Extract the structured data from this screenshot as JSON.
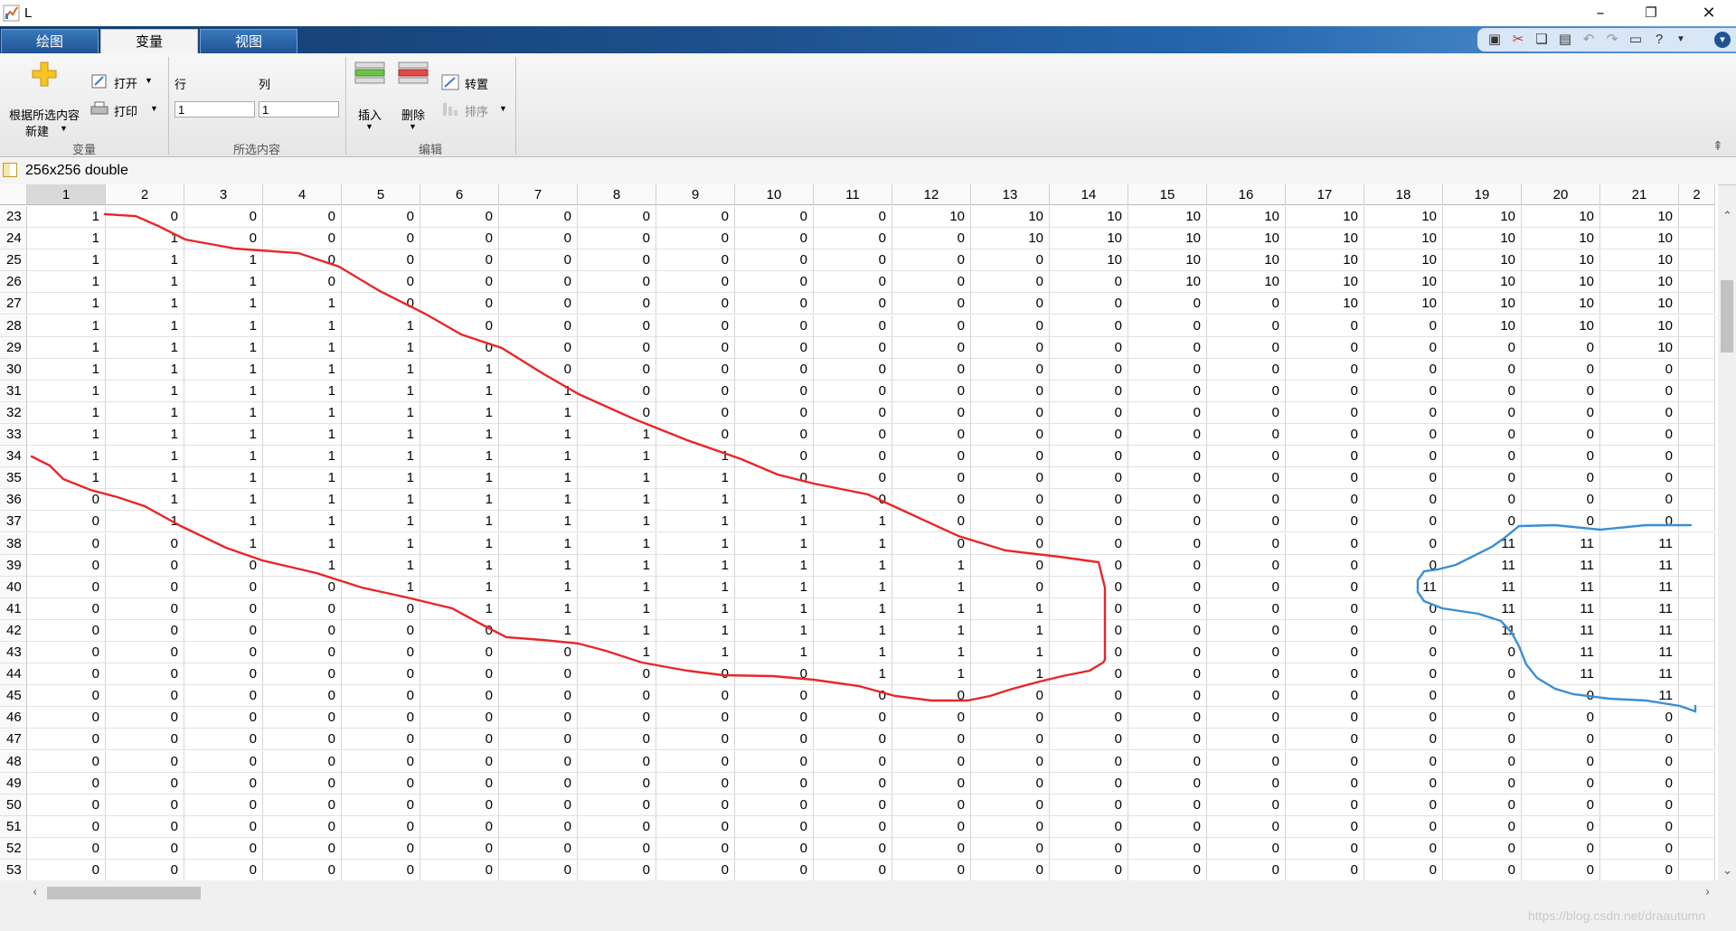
{
  "window": {
    "title": "L"
  },
  "ribbon_tabs": [
    "绘图",
    "变量",
    "视图"
  ],
  "ribbon": {
    "new_from_selection": [
      "根据所选内容",
      "新建"
    ],
    "open": "打开",
    "print": "打印",
    "row_label": "行",
    "col_label": "列",
    "row_value": "1",
    "col_value": "1",
    "insert": "插入",
    "delete": "删除",
    "transpose": "转置",
    "sort": "排序",
    "groups": [
      "变量",
      "所选内容",
      "编辑"
    ]
  },
  "variable": {
    "title": "256x256 double"
  },
  "table": {
    "columns": [
      "1",
      "2",
      "3",
      "4",
      "5",
      "6",
      "7",
      "8",
      "9",
      "10",
      "11",
      "12",
      "13",
      "14",
      "15",
      "16",
      "17",
      "18",
      "19",
      "20",
      "21",
      "2"
    ],
    "rows": [
      {
        "index": "23",
        "cells": [
          "1",
          "0",
          "0",
          "0",
          "0",
          "0",
          "0",
          "0",
          "0",
          "0",
          "0",
          "10",
          "10",
          "10",
          "10",
          "10",
          "10",
          "10",
          "10",
          "10",
          "10"
        ]
      },
      {
        "index": "24",
        "cells": [
          "1",
          "1",
          "0",
          "0",
          "0",
          "0",
          "0",
          "0",
          "0",
          "0",
          "0",
          "0",
          "10",
          "10",
          "10",
          "10",
          "10",
          "10",
          "10",
          "10",
          "10"
        ]
      },
      {
        "index": "25",
        "cells": [
          "1",
          "1",
          "1",
          "0",
          "0",
          "0",
          "0",
          "0",
          "0",
          "0",
          "0",
          "0",
          "0",
          "10",
          "10",
          "10",
          "10",
          "10",
          "10",
          "10",
          "10"
        ]
      },
      {
        "index": "26",
        "cells": [
          "1",
          "1",
          "1",
          "0",
          "0",
          "0",
          "0",
          "0",
          "0",
          "0",
          "0",
          "0",
          "0",
          "0",
          "10",
          "10",
          "10",
          "10",
          "10",
          "10",
          "10"
        ]
      },
      {
        "index": "27",
        "cells": [
          "1",
          "1",
          "1",
          "1",
          "0",
          "0",
          "0",
          "0",
          "0",
          "0",
          "0",
          "0",
          "0",
          "0",
          "0",
          "0",
          "10",
          "10",
          "10",
          "10",
          "10"
        ]
      },
      {
        "index": "28",
        "cells": [
          "1",
          "1",
          "1",
          "1",
          "1",
          "0",
          "0",
          "0",
          "0",
          "0",
          "0",
          "0",
          "0",
          "0",
          "0",
          "0",
          "0",
          "0",
          "10",
          "10",
          "10"
        ]
      },
      {
        "index": "29",
        "cells": [
          "1",
          "1",
          "1",
          "1",
          "1",
          "0",
          "0",
          "0",
          "0",
          "0",
          "0",
          "0",
          "0",
          "0",
          "0",
          "0",
          "0",
          "0",
          "0",
          "0",
          "10"
        ]
      },
      {
        "index": "30",
        "cells": [
          "1",
          "1",
          "1",
          "1",
          "1",
          "1",
          "0",
          "0",
          "0",
          "0",
          "0",
          "0",
          "0",
          "0",
          "0",
          "0",
          "0",
          "0",
          "0",
          "0",
          "0"
        ]
      },
      {
        "index": "31",
        "cells": [
          "1",
          "1",
          "1",
          "1",
          "1",
          "1",
          "1",
          "0",
          "0",
          "0",
          "0",
          "0",
          "0",
          "0",
          "0",
          "0",
          "0",
          "0",
          "0",
          "0",
          "0"
        ]
      },
      {
        "index": "32",
        "cells": [
          "1",
          "1",
          "1",
          "1",
          "1",
          "1",
          "1",
          "0",
          "0",
          "0",
          "0",
          "0",
          "0",
          "0",
          "0",
          "0",
          "0",
          "0",
          "0",
          "0",
          "0"
        ]
      },
      {
        "index": "33",
        "cells": [
          "1",
          "1",
          "1",
          "1",
          "1",
          "1",
          "1",
          "1",
          "0",
          "0",
          "0",
          "0",
          "0",
          "0",
          "0",
          "0",
          "0",
          "0",
          "0",
          "0",
          "0"
        ]
      },
      {
        "index": "34",
        "cells": [
          "1",
          "1",
          "1",
          "1",
          "1",
          "1",
          "1",
          "1",
          "1",
          "0",
          "0",
          "0",
          "0",
          "0",
          "0",
          "0",
          "0",
          "0",
          "0",
          "0",
          "0"
        ]
      },
      {
        "index": "35",
        "cells": [
          "1",
          "1",
          "1",
          "1",
          "1",
          "1",
          "1",
          "1",
          "1",
          "0",
          "0",
          "0",
          "0",
          "0",
          "0",
          "0",
          "0",
          "0",
          "0",
          "0",
          "0"
        ]
      },
      {
        "index": "36",
        "cells": [
          "0",
          "1",
          "1",
          "1",
          "1",
          "1",
          "1",
          "1",
          "1",
          "1",
          "0",
          "0",
          "0",
          "0",
          "0",
          "0",
          "0",
          "0",
          "0",
          "0",
          "0"
        ]
      },
      {
        "index": "37",
        "cells": [
          "0",
          "1",
          "1",
          "1",
          "1",
          "1",
          "1",
          "1",
          "1",
          "1",
          "1",
          "0",
          "0",
          "0",
          "0",
          "0",
          "0",
          "0",
          "0",
          "0",
          "0"
        ]
      },
      {
        "index": "38",
        "cells": [
          "0",
          "0",
          "1",
          "1",
          "1",
          "1",
          "1",
          "1",
          "1",
          "1",
          "1",
          "0",
          "0",
          "0",
          "0",
          "0",
          "0",
          "0",
          "11",
          "11",
          "11"
        ]
      },
      {
        "index": "39",
        "cells": [
          "0",
          "0",
          "0",
          "1",
          "1",
          "1",
          "1",
          "1",
          "1",
          "1",
          "1",
          "1",
          "0",
          "0",
          "0",
          "0",
          "0",
          "0",
          "11",
          "11",
          "11"
        ]
      },
      {
        "index": "40",
        "cells": [
          "0",
          "0",
          "0",
          "0",
          "1",
          "1",
          "1",
          "1",
          "1",
          "1",
          "1",
          "1",
          "0",
          "0",
          "0",
          "0",
          "0",
          "11",
          "11",
          "11",
          "11"
        ]
      },
      {
        "index": "41",
        "cells": [
          "0",
          "0",
          "0",
          "0",
          "0",
          "1",
          "1",
          "1",
          "1",
          "1",
          "1",
          "1",
          "1",
          "0",
          "0",
          "0",
          "0",
          "0",
          "11",
          "11",
          "11"
        ]
      },
      {
        "index": "42",
        "cells": [
          "0",
          "0",
          "0",
          "0",
          "0",
          "0",
          "1",
          "1",
          "1",
          "1",
          "1",
          "1",
          "1",
          "0",
          "0",
          "0",
          "0",
          "0",
          "11",
          "11",
          "11"
        ]
      },
      {
        "index": "43",
        "cells": [
          "0",
          "0",
          "0",
          "0",
          "0",
          "0",
          "0",
          "1",
          "1",
          "1",
          "1",
          "1",
          "1",
          "0",
          "0",
          "0",
          "0",
          "0",
          "0",
          "11",
          "11"
        ]
      },
      {
        "index": "44",
        "cells": [
          "0",
          "0",
          "0",
          "0",
          "0",
          "0",
          "0",
          "0",
          "0",
          "0",
          "1",
          "1",
          "1",
          "0",
          "0",
          "0",
          "0",
          "0",
          "0",
          "11",
          "11"
        ]
      },
      {
        "index": "45",
        "cells": [
          "0",
          "0",
          "0",
          "0",
          "0",
          "0",
          "0",
          "0",
          "0",
          "0",
          "0",
          "0",
          "0",
          "0",
          "0",
          "0",
          "0",
          "0",
          "0",
          "0",
          "11"
        ]
      },
      {
        "index": "46",
        "cells": [
          "0",
          "0",
          "0",
          "0",
          "0",
          "0",
          "0",
          "0",
          "0",
          "0",
          "0",
          "0",
          "0",
          "0",
          "0",
          "0",
          "0",
          "0",
          "0",
          "0",
          "0"
        ]
      },
      {
        "index": "47",
        "cells": [
          "0",
          "0",
          "0",
          "0",
          "0",
          "0",
          "0",
          "0",
          "0",
          "0",
          "0",
          "0",
          "0",
          "0",
          "0",
          "0",
          "0",
          "0",
          "0",
          "0",
          "0"
        ]
      },
      {
        "index": "48",
        "cells": [
          "0",
          "0",
          "0",
          "0",
          "0",
          "0",
          "0",
          "0",
          "0",
          "0",
          "0",
          "0",
          "0",
          "0",
          "0",
          "0",
          "0",
          "0",
          "0",
          "0",
          "0"
        ]
      },
      {
        "index": "49",
        "cells": [
          "0",
          "0",
          "0",
          "0",
          "0",
          "0",
          "0",
          "0",
          "0",
          "0",
          "0",
          "0",
          "0",
          "0",
          "0",
          "0",
          "0",
          "0",
          "0",
          "0",
          "0"
        ]
      },
      {
        "index": "50",
        "cells": [
          "0",
          "0",
          "0",
          "0",
          "0",
          "0",
          "0",
          "0",
          "0",
          "0",
          "0",
          "0",
          "0",
          "0",
          "0",
          "0",
          "0",
          "0",
          "0",
          "0",
          "0"
        ]
      },
      {
        "index": "51",
        "cells": [
          "0",
          "0",
          "0",
          "0",
          "0",
          "0",
          "0",
          "0",
          "0",
          "0",
          "0",
          "0",
          "0",
          "0",
          "0",
          "0",
          "0",
          "0",
          "0",
          "0",
          "0"
        ]
      },
      {
        "index": "52",
        "cells": [
          "0",
          "0",
          "0",
          "0",
          "0",
          "0",
          "0",
          "0",
          "0",
          "0",
          "0",
          "0",
          "0",
          "0",
          "0",
          "0",
          "0",
          "0",
          "0",
          "0",
          "0"
        ]
      },
      {
        "index": "53",
        "cells": [
          "0",
          "0",
          "0",
          "0",
          "0",
          "0",
          "0",
          "0",
          "0",
          "0",
          "0",
          "0",
          "0",
          "0",
          "0",
          "0",
          "0",
          "0",
          "0",
          "0",
          "0"
        ]
      }
    ]
  },
  "annotations": {
    "region1_color": "#e8262a",
    "region2_color": "#3a8fd6"
  },
  "watermark": "https://blog.csdn.net/draautumn"
}
